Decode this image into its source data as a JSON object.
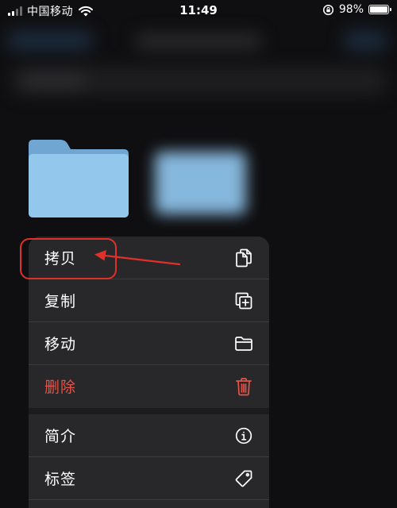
{
  "status_bar": {
    "carrier": "中国移动",
    "time": "11:49",
    "battery_percent": "98%",
    "battery_level": 0.98,
    "signal_bars_active": 2,
    "signal_bars_total": 4
  },
  "menu": {
    "items": [
      {
        "label": "拷贝",
        "icon": "copy-icon"
      },
      {
        "label": "复制",
        "icon": "duplicate-icon"
      },
      {
        "label": "移动",
        "icon": "folder-icon"
      },
      {
        "label": "删除",
        "icon": "trash-icon",
        "destructive": true
      },
      {
        "label": "简介",
        "icon": "info-icon"
      },
      {
        "label": "标签",
        "icon": "tag-icon"
      }
    ]
  },
  "colors": {
    "background": "#0f0f11",
    "menu_background": "#28282a",
    "destructive": "#e5544a",
    "annotation": "#e0302a",
    "folder_blue": "#8ec3ea"
  }
}
